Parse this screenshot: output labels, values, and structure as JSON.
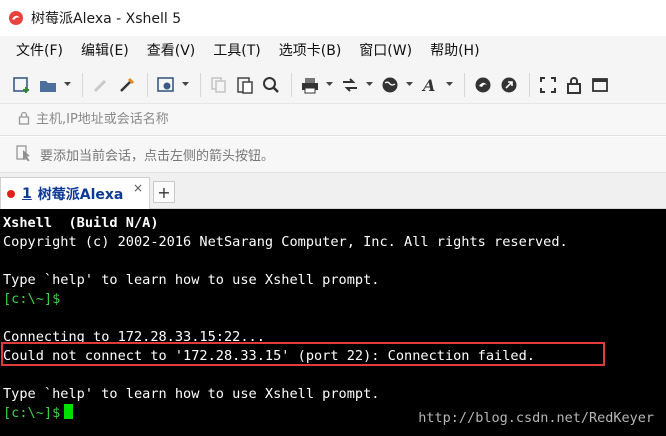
{
  "window": {
    "title": "树莓派Alexa - Xshell 5"
  },
  "menu": [
    "文件(F)",
    "编辑(E)",
    "查看(V)",
    "工具(T)",
    "选项卡(B)",
    "窗口(W)",
    "帮助(H)"
  ],
  "toolbar_icons": [
    "new-session-icon",
    "open-folder-icon",
    "reconnect-icon",
    "disconnect-icon",
    "properties-icon",
    "copy-icon",
    "paste-icon",
    "find-icon",
    "print-icon",
    "transfer-icon",
    "globe-icon",
    "font-icon",
    "xshell-icon",
    "xftp-icon",
    "fullscreen-icon",
    "lock-icon",
    "more-icon"
  ],
  "address": {
    "placeholder": "主机,IP地址或会话名称"
  },
  "hint": {
    "text": "要添加当前会话，点击左侧的箭头按钮。"
  },
  "tab": {
    "number": "1",
    "label": "树莓派Alexa",
    "close": "×",
    "add": "+"
  },
  "terminal": {
    "lines": {
      "l1": "Xshell  (Build N/A)",
      "l2": "Copyright (c) 2002-2016 NetSarang Computer, Inc. All rights reserved.",
      "l3": "",
      "l4": "Type `help' to learn how to use Xshell prompt.",
      "prompt1": "[c:\\~]$",
      "l6": "",
      "l7": "Connecting to 172.28.33.15:22...",
      "l8": "Could not connect to '172.28.33.15' (port 22): Connection failed.",
      "l9": "",
      "l10": "Type `help' to learn how to use Xshell prompt.",
      "prompt2": "[c:\\~]$"
    }
  },
  "watermark": "http://blog.csdn.net/RedKeyer",
  "colors": {
    "terminal_bg": "#000000",
    "prompt": "#3ecf48",
    "cursor": "#00e000",
    "error_box": "#e03a3a",
    "tab_text": "#0d3a96"
  }
}
